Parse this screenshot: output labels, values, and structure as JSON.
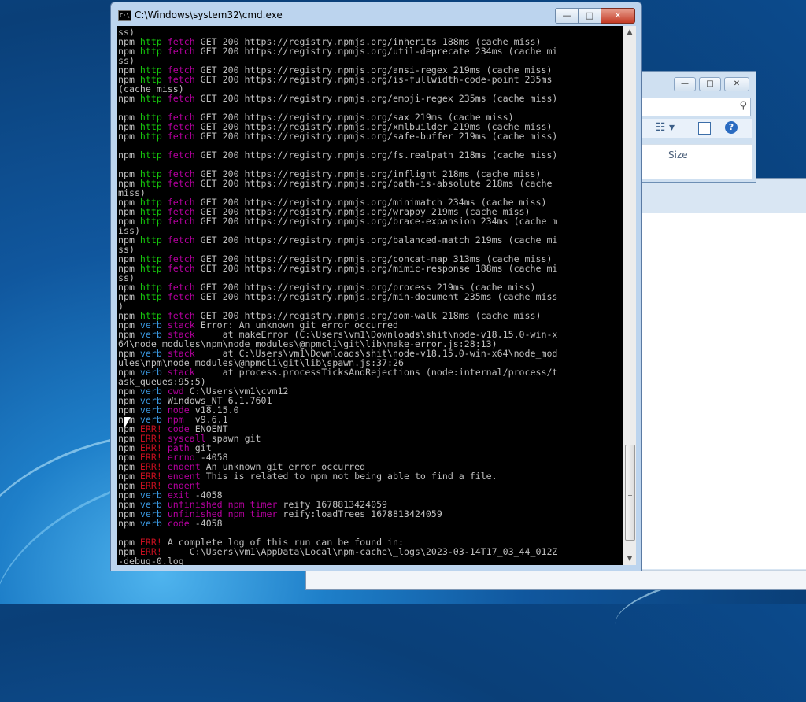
{
  "cmd_window": {
    "title": "C:\\Windows\\system32\\cmd.exe",
    "icon_text": "C:\\",
    "min_label": "—",
    "max_label": "□",
    "close_label": "✕"
  },
  "explorer_window": {
    "min_label": "—",
    "max_label": "□",
    "close_label": "✕",
    "search_icon": "⚲",
    "views_label": "☷ ▾",
    "help_label": "?",
    "column_size": "Size"
  },
  "scrollbar": {
    "up": "▲",
    "down": "▼"
  },
  "console_lines": [
    [
      [
        "w",
        "ss)"
      ]
    ],
    [
      [
        "w",
        "npm "
      ],
      [
        "g",
        "http "
      ],
      [
        "m",
        "fetch"
      ],
      [
        "w",
        " GET 200 https://registry.npmjs.org/inherits 188ms (cache miss)"
      ]
    ],
    [
      [
        "w",
        "npm "
      ],
      [
        "g",
        "http "
      ],
      [
        "m",
        "fetch"
      ],
      [
        "w",
        " GET 200 https://registry.npmjs.org/util-deprecate 234ms (cache mi"
      ]
    ],
    [
      [
        "w",
        "ss)"
      ]
    ],
    [
      [
        "w",
        "npm "
      ],
      [
        "g",
        "http "
      ],
      [
        "m",
        "fetch"
      ],
      [
        "w",
        " GET 200 https://registry.npmjs.org/ansi-regex 219ms (cache miss)"
      ]
    ],
    [
      [
        "w",
        "npm "
      ],
      [
        "g",
        "http "
      ],
      [
        "m",
        "fetch"
      ],
      [
        "w",
        " GET 200 https://registry.npmjs.org/is-fullwidth-code-point 235ms"
      ]
    ],
    [
      [
        "w",
        "(cache miss)"
      ]
    ],
    [
      [
        "w",
        "npm "
      ],
      [
        "g",
        "http "
      ],
      [
        "m",
        "fetch"
      ],
      [
        "w",
        " GET 200 https://registry.npmjs.org/emoji-regex 235ms (cache miss)"
      ]
    ],
    [
      [
        "w",
        ""
      ]
    ],
    [
      [
        "w",
        "npm "
      ],
      [
        "g",
        "http "
      ],
      [
        "m",
        "fetch"
      ],
      [
        "w",
        " GET 200 https://registry.npmjs.org/sax 219ms (cache miss)"
      ]
    ],
    [
      [
        "w",
        "npm "
      ],
      [
        "g",
        "http "
      ],
      [
        "m",
        "fetch"
      ],
      [
        "w",
        " GET 200 https://registry.npmjs.org/xmlbuilder 219ms (cache miss)"
      ]
    ],
    [
      [
        "w",
        "npm "
      ],
      [
        "g",
        "http "
      ],
      [
        "m",
        "fetch"
      ],
      [
        "w",
        " GET 200 https://registry.npmjs.org/safe-buffer 219ms (cache miss)"
      ]
    ],
    [
      [
        "w",
        ""
      ]
    ],
    [
      [
        "w",
        "npm "
      ],
      [
        "g",
        "http "
      ],
      [
        "m",
        "fetch"
      ],
      [
        "w",
        " GET 200 https://registry.npmjs.org/fs.realpath 218ms (cache miss)"
      ]
    ],
    [
      [
        "w",
        ""
      ]
    ],
    [
      [
        "w",
        "npm "
      ],
      [
        "g",
        "http "
      ],
      [
        "m",
        "fetch"
      ],
      [
        "w",
        " GET 200 https://registry.npmjs.org/inflight 218ms (cache miss)"
      ]
    ],
    [
      [
        "w",
        "npm "
      ],
      [
        "g",
        "http "
      ],
      [
        "m",
        "fetch"
      ],
      [
        "w",
        " GET 200 https://registry.npmjs.org/path-is-absolute 218ms (cache"
      ]
    ],
    [
      [
        "w",
        "miss)"
      ]
    ],
    [
      [
        "w",
        "npm "
      ],
      [
        "g",
        "http "
      ],
      [
        "m",
        "fetch"
      ],
      [
        "w",
        " GET 200 https://registry.npmjs.org/minimatch 234ms (cache miss)"
      ]
    ],
    [
      [
        "w",
        "npm "
      ],
      [
        "g",
        "http "
      ],
      [
        "m",
        "fetch"
      ],
      [
        "w",
        " GET 200 https://registry.npmjs.org/wrappy 219ms (cache miss)"
      ]
    ],
    [
      [
        "w",
        "npm "
      ],
      [
        "g",
        "http "
      ],
      [
        "m",
        "fetch"
      ],
      [
        "w",
        " GET 200 https://registry.npmjs.org/brace-expansion 234ms (cache m"
      ]
    ],
    [
      [
        "w",
        "iss)"
      ]
    ],
    [
      [
        "w",
        "npm "
      ],
      [
        "g",
        "http "
      ],
      [
        "m",
        "fetch"
      ],
      [
        "w",
        " GET 200 https://registry.npmjs.org/balanced-match 219ms (cache mi"
      ]
    ],
    [
      [
        "w",
        "ss)"
      ]
    ],
    [
      [
        "w",
        "npm "
      ],
      [
        "g",
        "http "
      ],
      [
        "m",
        "fetch"
      ],
      [
        "w",
        " GET 200 https://registry.npmjs.org/concat-map 313ms (cache miss)"
      ]
    ],
    [
      [
        "w",
        "npm "
      ],
      [
        "g",
        "http "
      ],
      [
        "m",
        "fetch"
      ],
      [
        "w",
        " GET 200 https://registry.npmjs.org/mimic-response 188ms (cache mi"
      ]
    ],
    [
      [
        "w",
        "ss)"
      ]
    ],
    [
      [
        "w",
        "npm "
      ],
      [
        "g",
        "http "
      ],
      [
        "m",
        "fetch"
      ],
      [
        "w",
        " GET 200 https://registry.npmjs.org/process 219ms (cache miss)"
      ]
    ],
    [
      [
        "w",
        "npm "
      ],
      [
        "g",
        "http "
      ],
      [
        "m",
        "fetch"
      ],
      [
        "w",
        " GET 200 https://registry.npmjs.org/min-document 235ms (cache miss"
      ]
    ],
    [
      [
        "w",
        ")"
      ]
    ],
    [
      [
        "w",
        "npm "
      ],
      [
        "g",
        "http "
      ],
      [
        "m",
        "fetch"
      ],
      [
        "w",
        " GET 200 https://registry.npmjs.org/dom-walk 218ms (cache miss)"
      ]
    ],
    [
      [
        "w",
        "npm "
      ],
      [
        "c",
        "verb "
      ],
      [
        "m",
        "stack"
      ],
      [
        "w",
        " Error: An unknown git error occurred"
      ]
    ],
    [
      [
        "w",
        "npm "
      ],
      [
        "c",
        "verb "
      ],
      [
        "m",
        "stack"
      ],
      [
        "w",
        "     at makeError (C:\\Users\\vm1\\Downloads\\shit\\node-v18.15.0-win-x"
      ]
    ],
    [
      [
        "w",
        "64\\node_modules\\npm\\node_modules\\@npmcli\\git\\lib\\make-error.js:28:13)"
      ]
    ],
    [
      [
        "w",
        "npm "
      ],
      [
        "c",
        "verb "
      ],
      [
        "m",
        "stack"
      ],
      [
        "w",
        "     at C:\\Users\\vm1\\Downloads\\shit\\node-v18.15.0-win-x64\\node_mod"
      ]
    ],
    [
      [
        "w",
        "ules\\npm\\node_modules\\@npmcli\\git\\lib\\spawn.js:37:26"
      ]
    ],
    [
      [
        "w",
        "npm "
      ],
      [
        "c",
        "verb "
      ],
      [
        "m",
        "stack"
      ],
      [
        "w",
        "     at process.processTicksAndRejections (node:internal/process/t"
      ]
    ],
    [
      [
        "w",
        "ask_queues:95:5)"
      ]
    ],
    [
      [
        "w",
        "npm "
      ],
      [
        "c",
        "verb "
      ],
      [
        "m",
        "cwd"
      ],
      [
        "w",
        " C:\\Users\\vm1\\cvm12"
      ]
    ],
    [
      [
        "w",
        "npm "
      ],
      [
        "c",
        "verb "
      ],
      [
        "w",
        "Windows_NT 6.1.7601"
      ]
    ],
    [
      [
        "w",
        "npm "
      ],
      [
        "c",
        "verb "
      ],
      [
        "m",
        "node"
      ],
      [
        "w",
        " v18.15.0"
      ]
    ],
    [
      [
        "w",
        "npm "
      ],
      [
        "c",
        "verb "
      ],
      [
        "m",
        "npm "
      ],
      [
        "w",
        " v9.6.1"
      ]
    ],
    [
      [
        "w",
        "npm "
      ],
      [
        "r",
        "ERR!"
      ],
      [
        "w",
        " "
      ],
      [
        "m",
        "code"
      ],
      [
        "w",
        " ENOENT"
      ]
    ],
    [
      [
        "w",
        "npm "
      ],
      [
        "r",
        "ERR!"
      ],
      [
        "w",
        " "
      ],
      [
        "m",
        "syscall"
      ],
      [
        "w",
        " spawn git"
      ]
    ],
    [
      [
        "w",
        "npm "
      ],
      [
        "r",
        "ERR!"
      ],
      [
        "w",
        " "
      ],
      [
        "m",
        "path"
      ],
      [
        "w",
        " git"
      ]
    ],
    [
      [
        "w",
        "npm "
      ],
      [
        "r",
        "ERR!"
      ],
      [
        "w",
        " "
      ],
      [
        "m",
        "errno"
      ],
      [
        "w",
        " -4058"
      ]
    ],
    [
      [
        "w",
        "npm "
      ],
      [
        "r",
        "ERR!"
      ],
      [
        "w",
        " "
      ],
      [
        "m",
        "enoent"
      ],
      [
        "w",
        " An unknown git error occurred"
      ]
    ],
    [
      [
        "w",
        "npm "
      ],
      [
        "r",
        "ERR!"
      ],
      [
        "w",
        " "
      ],
      [
        "m",
        "enoent"
      ],
      [
        "w",
        " This is related to npm not being able to find a file."
      ]
    ],
    [
      [
        "w",
        "npm "
      ],
      [
        "r",
        "ERR!"
      ],
      [
        "w",
        " "
      ],
      [
        "m",
        "enoent"
      ]
    ],
    [
      [
        "w",
        "npm "
      ],
      [
        "c",
        "verb "
      ],
      [
        "m",
        "exit"
      ],
      [
        "w",
        " -4058"
      ]
    ],
    [
      [
        "w",
        "npm "
      ],
      [
        "c",
        "verb "
      ],
      [
        "m",
        "unfinished npm timer"
      ],
      [
        "w",
        " reify 1678813424059"
      ]
    ],
    [
      [
        "w",
        "npm "
      ],
      [
        "c",
        "verb "
      ],
      [
        "m",
        "unfinished npm timer"
      ],
      [
        "w",
        " reify:loadTrees 1678813424059"
      ]
    ],
    [
      [
        "w",
        "npm "
      ],
      [
        "c",
        "verb "
      ],
      [
        "m",
        "code"
      ],
      [
        "w",
        " -4058"
      ]
    ],
    [
      [
        "w",
        ""
      ]
    ],
    [
      [
        "w",
        "npm "
      ],
      [
        "r",
        "ERR!"
      ],
      [
        "w",
        " A complete log of this run can be found in:"
      ]
    ],
    [
      [
        "w",
        "npm "
      ],
      [
        "r",
        "ERR!"
      ],
      [
        "w",
        "     C:\\Users\\vm1\\AppData\\Local\\npm-cache\\_logs\\2023-03-14T17_03_44_012Z"
      ]
    ],
    [
      [
        "w",
        "-debug-0.log"
      ]
    ]
  ]
}
